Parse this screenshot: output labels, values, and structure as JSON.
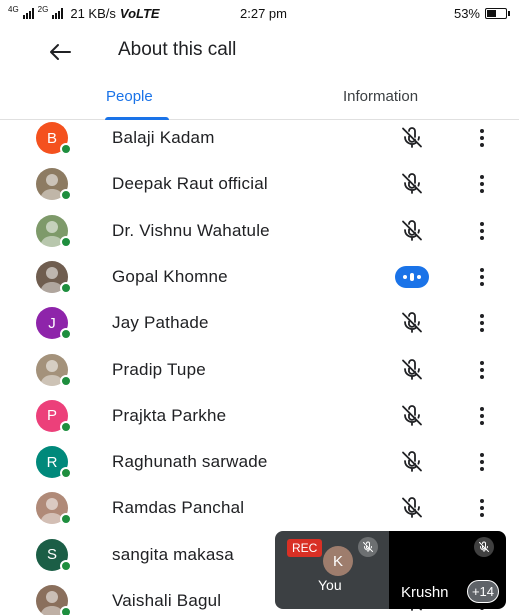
{
  "status_bar": {
    "signal_label": "4G",
    "signal_label2": "2G",
    "speed": "21 KB/s",
    "volte": "VoLTE",
    "time": "2:27 pm",
    "battery_percent": "53%",
    "battery_level": 0.53
  },
  "header": {
    "back_icon": "arrow-left-icon",
    "title": "About this call"
  },
  "tabs": [
    {
      "label": "People",
      "selected": true
    },
    {
      "label": "Information",
      "selected": false
    }
  ],
  "participants": [
    {
      "name": "Balaji Kadam",
      "initial": "B",
      "avatar_color": "#f4511e",
      "photo": false,
      "mic": "muted"
    },
    {
      "name": "Deepak Raut official",
      "initial": "",
      "avatar_color": "#8d7b62",
      "photo": true,
      "mic": "muted"
    },
    {
      "name": "Dr. Vishnu Wahatule",
      "initial": "",
      "avatar_color": "#7e9a6a",
      "photo": true,
      "mic": "muted"
    },
    {
      "name": "Gopal Khomne",
      "initial": "",
      "avatar_color": "#6f5d4f",
      "photo": true,
      "mic": "speaking"
    },
    {
      "name": "Jay Pathade",
      "initial": "J",
      "avatar_color": "#8e24aa",
      "photo": false,
      "mic": "muted"
    },
    {
      "name": "Pradip Tupe",
      "initial": "",
      "avatar_color": "#a4927b",
      "photo": true,
      "mic": "muted"
    },
    {
      "name": "Prajkta Parkhe",
      "initial": "P",
      "avatar_color": "#ec407a",
      "photo": false,
      "mic": "muted"
    },
    {
      "name": "Raghunath sarwade",
      "initial": "R",
      "avatar_color": "#00897b",
      "photo": false,
      "mic": "muted"
    },
    {
      "name": "Ramdas Panchal",
      "initial": "",
      "avatar_color": "#b08a78",
      "photo": true,
      "mic": "muted"
    },
    {
      "name": "sangita makasa",
      "initial": "S",
      "avatar_color": "#1b5e46",
      "photo": false,
      "mic": "muted"
    },
    {
      "name": "Vaishali Bagul",
      "initial": "",
      "avatar_color": "#8a6f5c",
      "photo": true,
      "mic": "muted"
    }
  ],
  "pip": {
    "rec_label": "REC",
    "self_initial": "K",
    "self_label": "You",
    "remote_label": "Krushn",
    "extra_count": "+14"
  },
  "colors": {
    "accent": "#1a73e8",
    "presence": "#1e8e3e",
    "rec": "#d93025"
  }
}
